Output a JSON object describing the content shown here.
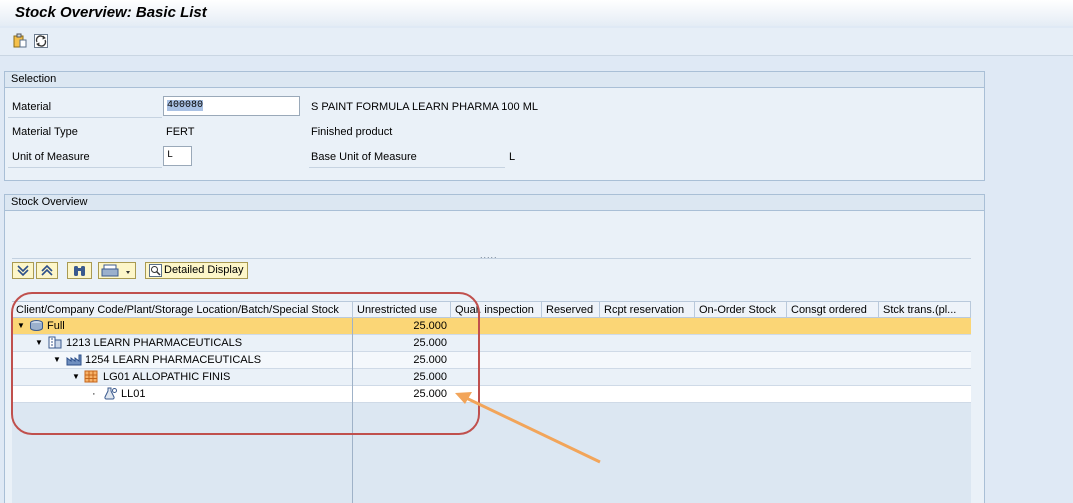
{
  "window": {
    "title": "Stock Overview: Basic List"
  },
  "toolbar": {
    "icons": [
      "clipboard-icon",
      "refresh-icon"
    ]
  },
  "selection": {
    "header": "Selection",
    "material_label": "Material",
    "material_value": "400080",
    "material_desc": "S PAINT FORMULA LEARN PHARMA 100 ML",
    "material_type_label": "Material Type",
    "material_type_value": "FERT",
    "material_type_desc": "Finished product",
    "uom_label": "Unit of Measure",
    "uom_value": "L",
    "base_uom_label": "Base Unit of Measure",
    "base_uom_value": "L"
  },
  "stock": {
    "header": "Stock Overview",
    "dots": ".....",
    "detailed_display": "Detailed Display",
    "columns": [
      "Client/Company Code/Plant/Storage Location/Batch/Special Stock",
      "Unrestricted use",
      "Qual. inspection",
      "Reserved",
      "Rcpt reservation",
      "On-Order Stock",
      "Consgt ordered",
      "Stck trans.(pl..."
    ],
    "rows": [
      {
        "label": "Full",
        "unrestricted": "25.000"
      },
      {
        "label": "1213 LEARN PHARMACEUTICALS",
        "unrestricted": "25.000"
      },
      {
        "label": "1254 LEARN PHARMACEUTICALS",
        "unrestricted": "25.000"
      },
      {
        "label": "LG01 ALLOPATHIC FINIS",
        "unrestricted": "25.000"
      },
      {
        "label": "LL01",
        "unrestricted": "25.000"
      }
    ]
  },
  "colors": {
    "highlight_row": "#fbd676",
    "annotation_circle": "#c0504d",
    "annotation_arrow": "#f2a55a"
  }
}
